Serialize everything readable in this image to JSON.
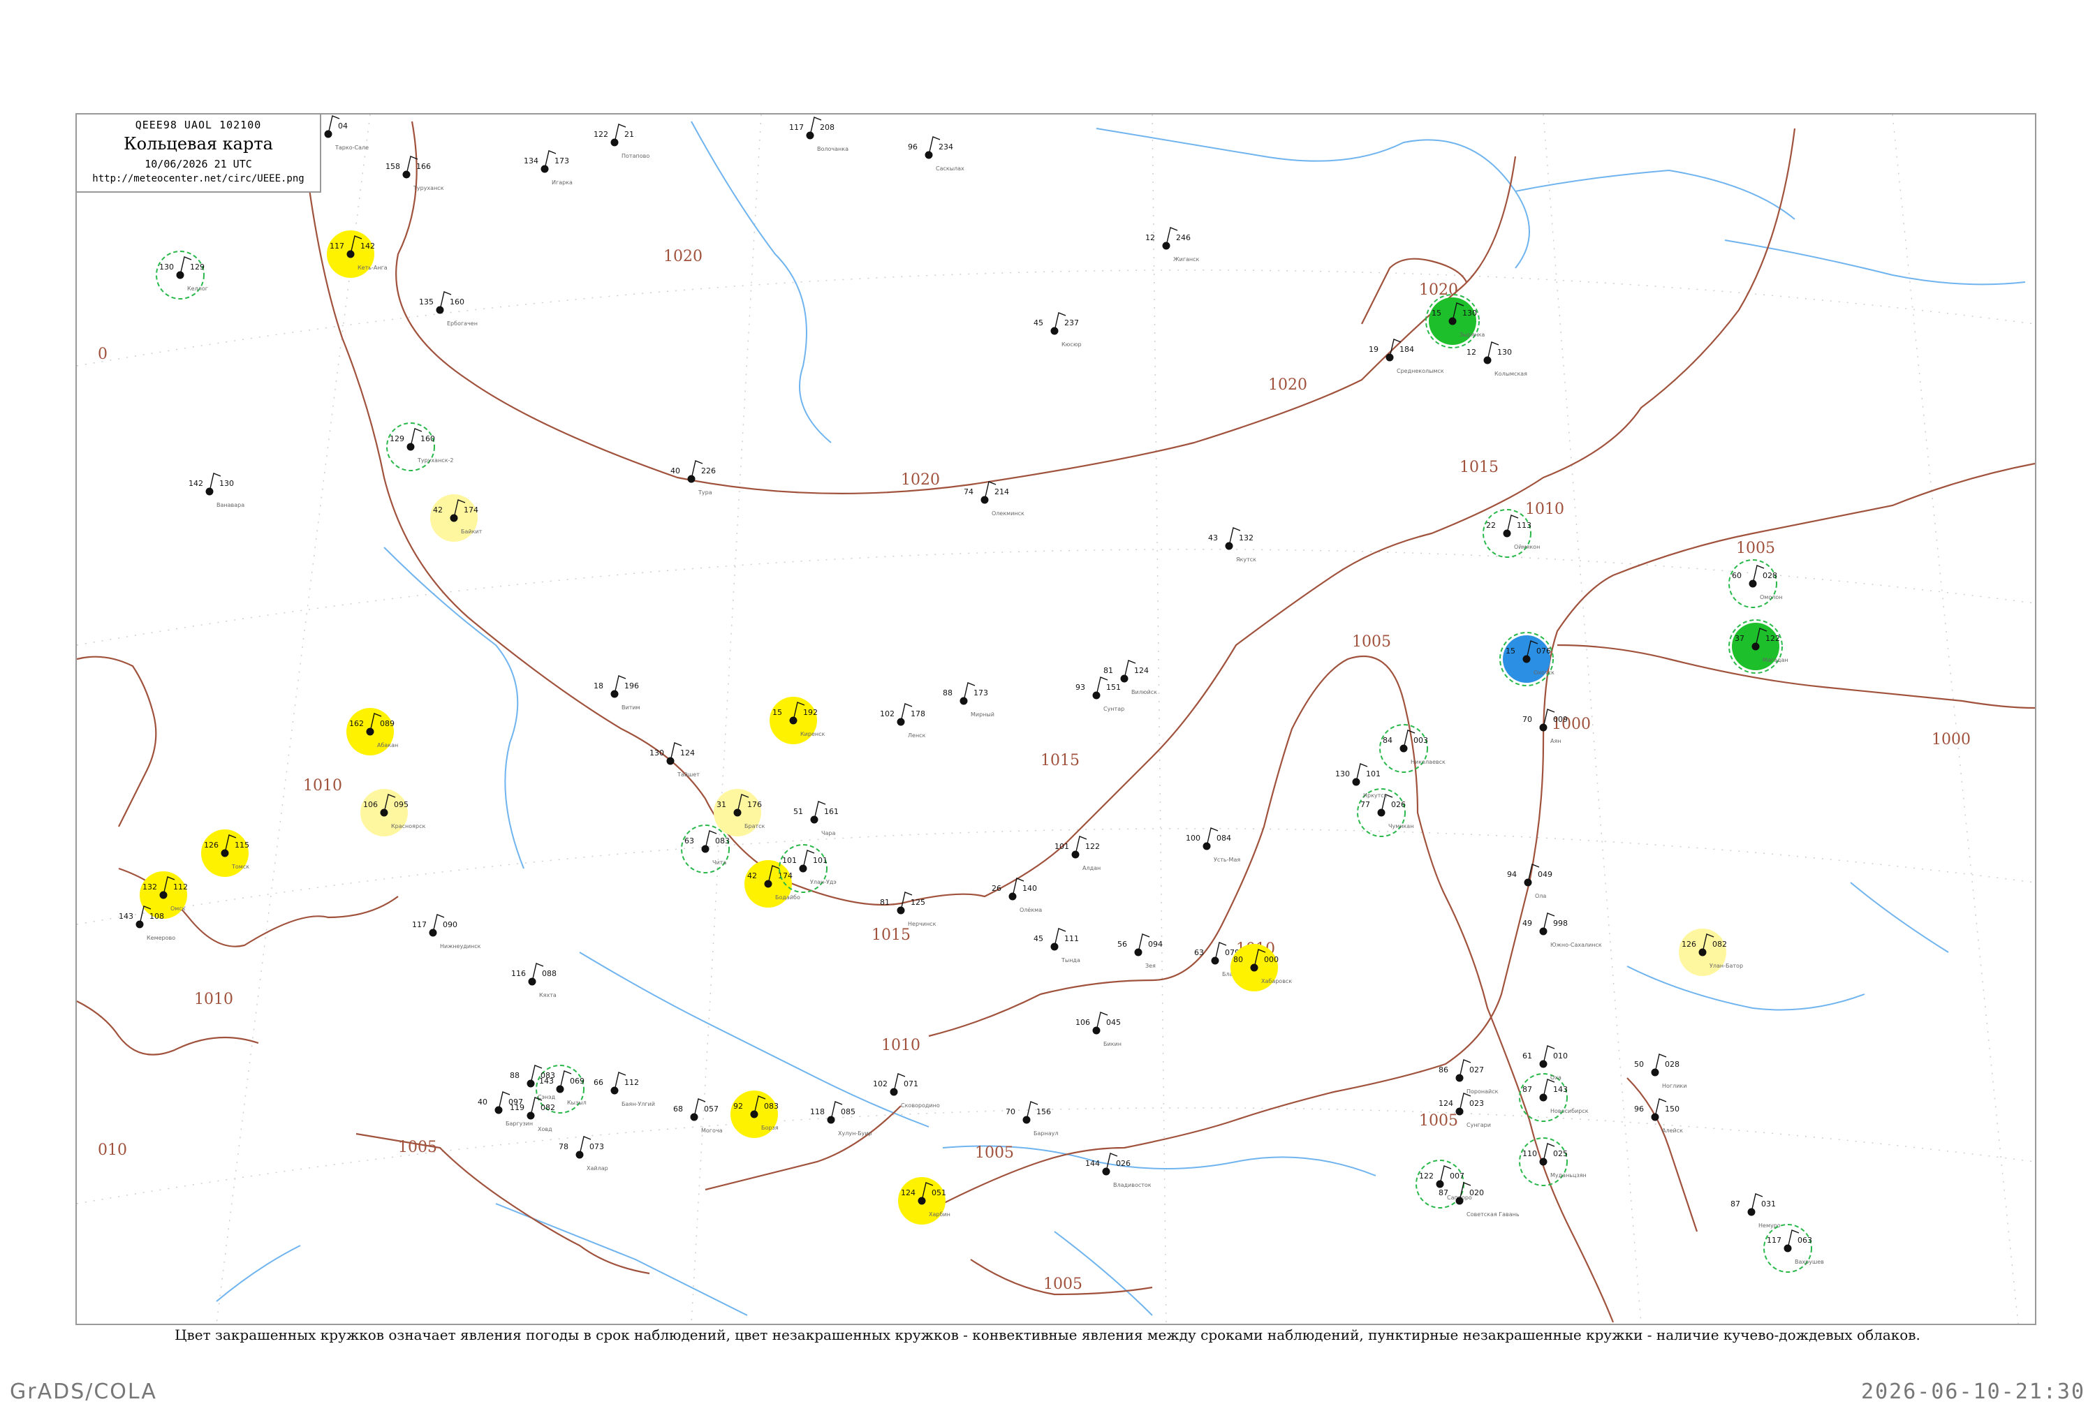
{
  "legend": {
    "code": "QEEE98  UAOL  102100",
    "title": "Кольцевая карта",
    "time": "10/06/2026 21 UTC",
    "url": "http://meteocenter.net/circ/UEEE.png"
  },
  "footnote": "Цвет закрашенных кружков означает явления погоды в срок наблюдений, цвет незакрашенных кружков - конвективные явления между сроками наблюдений, пунктирные незакрашенные кружки - наличие кучево-дождевых облаков.",
  "credit": "GrADS/COLA",
  "datestamp": "2026-06-10-21:30",
  "colors": {
    "isobar": "#a0523c",
    "river": "#6fb4ef",
    "yellow": "#fff200",
    "pale_yellow": "#fff7a0",
    "green": "#1dbf2b",
    "blue": "#2b8fe3",
    "cyan": "#2fe6c8",
    "dashed": "#29b94a"
  },
  "isobar_labels": [
    "1020",
    "1020",
    "1020",
    "1020",
    "1015",
    "1015",
    "1015",
    "1010",
    "1010",
    "1010",
    "1010",
    "1005",
    "1005",
    "1005",
    "1005",
    "1005",
    "1005",
    "1000",
    "1000",
    "1010",
    "010",
    "0"
  ],
  "stations": [
    {
      "name": "Тарко-Сале",
      "t": "137",
      "p": "04"
    },
    {
      "name": "Потапово",
      "t": "122",
      "p": "21"
    },
    {
      "name": "Волочанка",
      "t": "117",
      "p": "208"
    },
    {
      "name": "Саскылах",
      "t": "96",
      "p": "234"
    },
    {
      "name": "Игарка",
      "t": "134",
      "p": "173"
    },
    {
      "name": "Келлог",
      "t": "130",
      "p": "129"
    },
    {
      "name": "Кеть-Анга",
      "t": "117",
      "p": "142"
    },
    {
      "name": "Туруханск",
      "t": "158",
      "p": "166"
    },
    {
      "name": "Ербогачен",
      "t": "135",
      "p": "160"
    },
    {
      "name": "Жиганск",
      "t": "12",
      "p": "246"
    },
    {
      "name": "Кюсюр",
      "t": "45",
      "p": "237"
    },
    {
      "name": "Зырянка",
      "t": "15",
      "p": "130"
    },
    {
      "name": "Среднеколымск",
      "t": "19",
      "p": "184"
    },
    {
      "name": "Колымская",
      "t": "12",
      "p": "130"
    },
    {
      "name": "Тура",
      "t": "40",
      "p": "226"
    },
    {
      "name": "Ванавара",
      "t": "142",
      "p": "130"
    },
    {
      "name": "Туруханск-2",
      "t": "129",
      "p": "160"
    },
    {
      "name": "Байкит",
      "t": "42",
      "p": "174"
    },
    {
      "name": "Олекминск",
      "t": "74",
      "p": "214"
    },
    {
      "name": "Якутск",
      "t": "43",
      "p": "132"
    },
    {
      "name": "Оймякон",
      "t": "22",
      "p": "113"
    },
    {
      "name": "Омолон",
      "t": "60",
      "p": "028"
    },
    {
      "name": "Витим",
      "t": "18",
      "p": "196"
    },
    {
      "name": "Киренск",
      "t": "15",
      "p": "192"
    },
    {
      "name": "Ленск",
      "t": "102",
      "p": "178"
    },
    {
      "name": "Мирный",
      "t": "88",
      "p": "173"
    },
    {
      "name": "Сунтар",
      "t": "93",
      "p": "151"
    },
    {
      "name": "Вилюйск",
      "t": "81",
      "p": "124"
    },
    {
      "name": "Охотск",
      "t": "15",
      "p": "076"
    },
    {
      "name": "Магадан",
      "t": "37",
      "p": "122"
    },
    {
      "name": "Аян",
      "t": "70",
      "p": "009"
    },
    {
      "name": "Тайшет",
      "t": "130",
      "p": "124"
    },
    {
      "name": "Братск",
      "t": "31",
      "p": "176"
    },
    {
      "name": "Бодайбо",
      "t": "42",
      "p": "174"
    },
    {
      "name": "Чара",
      "t": "51",
      "p": "161"
    },
    {
      "name": "Олёкма",
      "t": "26",
      "p": "140"
    },
    {
      "name": "Алдан",
      "t": "101",
      "p": "122"
    },
    {
      "name": "Усть-Мая",
      "t": "100",
      "p": "084"
    },
    {
      "name": "Чумикан",
      "t": "77",
      "p": "026"
    },
    {
      "name": "Николаевск",
      "t": "84",
      "p": "003"
    },
    {
      "name": "Иркутск",
      "t": "130",
      "p": "101"
    },
    {
      "name": "Улан-Удэ",
      "t": "101",
      "p": "101"
    },
    {
      "name": "Чита",
      "t": "63",
      "p": "083"
    },
    {
      "name": "Нерчинск",
      "t": "81",
      "p": "125"
    },
    {
      "name": "Тында",
      "t": "45",
      "p": "111"
    },
    {
      "name": "Зея",
      "t": "56",
      "p": "094"
    },
    {
      "name": "Благовещенск",
      "t": "63",
      "p": "079"
    },
    {
      "name": "Хабаровск",
      "t": "80",
      "p": "000"
    },
    {
      "name": "Южно-Сахалинск",
      "t": "49",
      "p": "998"
    },
    {
      "name": "Улан-Батор",
      "t": "126",
      "p": "082"
    },
    {
      "name": "Кызыл",
      "t": "143",
      "p": "069"
    },
    {
      "name": "Ховд",
      "t": "119",
      "p": "082"
    },
    {
      "name": "Баян-Улгий",
      "t": "66",
      "p": "112"
    },
    {
      "name": "Хайлар",
      "t": "78",
      "p": "073"
    },
    {
      "name": "Харбин",
      "t": "124",
      "p": "051"
    },
    {
      "name": "Владивосток",
      "t": "144",
      "p": "026"
    },
    {
      "name": "Муданьцзян",
      "t": "110",
      "p": "025"
    },
    {
      "name": "Саппоро",
      "t": "122",
      "p": "007"
    },
    {
      "name": "Немуро",
      "t": "87",
      "p": "031"
    },
    {
      "name": "Вахрушев",
      "t": "117",
      "p": "063"
    },
    {
      "name": "Новосибирск",
      "t": "87",
      "p": "143"
    },
    {
      "name": "Барнаул",
      "t": "70",
      "p": "156"
    },
    {
      "name": "Омск",
      "t": "132",
      "p": "112"
    },
    {
      "name": "Томск",
      "t": "126",
      "p": "115"
    },
    {
      "name": "Кемерово",
      "t": "143",
      "p": "108"
    },
    {
      "name": "Красноярск",
      "t": "106",
      "p": "095"
    },
    {
      "name": "Абакан",
      "t": "162",
      "p": "089"
    },
    {
      "name": "Нижнеудинск",
      "t": "117",
      "p": "090"
    },
    {
      "name": "Кяхта",
      "t": "116",
      "p": "088"
    },
    {
      "name": "Сэнэд",
      "t": "88",
      "p": "083"
    },
    {
      "name": "Баргузин",
      "t": "40",
      "p": "097"
    },
    {
      "name": "Могоча",
      "t": "68",
      "p": "057"
    },
    {
      "name": "Борзя",
      "t": "92",
      "p": "083"
    },
    {
      "name": "Хулун-Буир",
      "t": "118",
      "p": "085"
    },
    {
      "name": "Сковородино",
      "t": "102",
      "p": "071"
    },
    {
      "name": "Бикин",
      "t": "106",
      "p": "045"
    },
    {
      "name": "Сунгари",
      "t": "124",
      "p": "023"
    },
    {
      "name": "Советская Гавань",
      "t": "87",
      "p": "020"
    },
    {
      "name": "Поронайск",
      "t": "86",
      "p": "027"
    },
    {
      "name": "Ола",
      "t": "94",
      "p": "049"
    },
    {
      "name": "Оха",
      "t": "61",
      "p": "010"
    },
    {
      "name": "Ноглики",
      "t": "50",
      "p": "028"
    },
    {
      "name": "Алейск",
      "t": "96",
      "p": "150"
    }
  ]
}
